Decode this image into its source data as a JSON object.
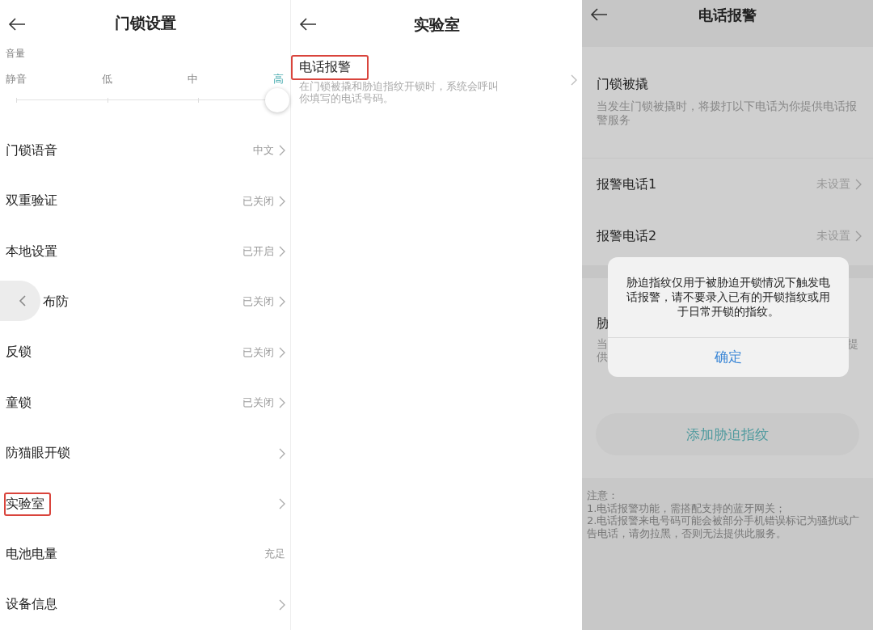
{
  "panels": [
    {
      "title": "门锁设置",
      "volume": {
        "label": "音量",
        "level": 1,
        "steps": [
          {
            "label": "静音",
            "selected": false
          },
          {
            "label": "低",
            "selected": false
          },
          {
            "label": "中",
            "selected": false
          },
          {
            "label": "高",
            "selected": true
          }
        ]
      },
      "items": [
        {
          "label": "门锁语音",
          "value": "中文",
          "chevron": true,
          "highlighted": false,
          "partly_covered": false
        },
        {
          "label": "双重验证",
          "value": "已关闭",
          "chevron": true,
          "highlighted": false,
          "partly_covered": false
        },
        {
          "label": "本地设置",
          "value": "已开启",
          "chevron": true,
          "highlighted": false,
          "partly_covered": false
        },
        {
          "label": "布防",
          "value": "已关闭",
          "chevron": true,
          "highlighted": false,
          "partly_covered": true
        },
        {
          "label": "反锁",
          "value": "已关闭",
          "chevron": true,
          "highlighted": false,
          "partly_covered": false
        },
        {
          "label": "童锁",
          "value": "已关闭",
          "chevron": true,
          "highlighted": false,
          "partly_covered": false
        },
        {
          "label": "防猫眼开锁",
          "chevron": true,
          "highlighted": false,
          "partly_covered": false
        },
        {
          "label": "实验室",
          "chevron": true,
          "highlighted": true,
          "partly_covered": false
        },
        {
          "label": "电池电量",
          "value": "充足",
          "chevron": false,
          "highlighted": false,
          "partly_covered": false
        },
        {
          "label": "设备信息",
          "chevron": true,
          "highlighted": false,
          "partly_covered": false
        }
      ]
    },
    {
      "title": "实验室",
      "items": [
        {
          "label": "电话报警",
          "description": "在门锁被撬和胁迫指纹开锁时，系统会呼叫你填写的电话号码。",
          "highlighted": true
        }
      ]
    },
    {
      "title": "电话报警",
      "section": {
        "title": "门锁被撬",
        "description": "当发生门锁被撬时，将拨打以下电话为你提供电话报警服务"
      },
      "phones": [
        {
          "label": "报警电话1",
          "value": "未设置"
        },
        {
          "label": "报警电话2",
          "value": "未设置"
        }
      ],
      "partial_section": {
        "title": "胁",
        "desc_left": [
          "当",
          "供"
        ],
        "desc_right": "提"
      },
      "button": "添加胁迫指纹",
      "notes": [
        "注意：",
        "1.电话报警功能，需搭配支持的蓝牙网关；",
        "2.电话报警来电号码可能会被部分手机错误标记为骚扰或广告电话，请勿拉黑，否则无法提供此服务。"
      ],
      "dialog": {
        "message": "胁迫指纹仅用于被胁迫开锁情况下触发电话报警，请不要录入已有的开锁指纹或用于日常开锁的指纹。",
        "button": "确定"
      }
    }
  ]
}
